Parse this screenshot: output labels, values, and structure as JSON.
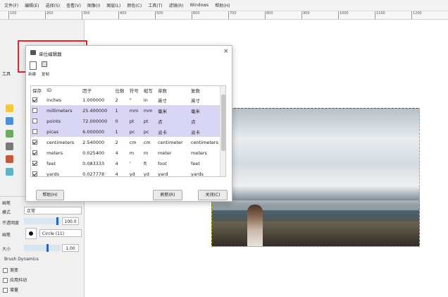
{
  "menu": [
    "文件(F)",
    "编辑(E)",
    "选择(S)",
    "查看(V)",
    "图像(I)",
    "图层(L)",
    "颜色(C)",
    "工具(T)",
    "滤镜(R)",
    "Windows",
    "帮助(H)"
  ],
  "ruler": [
    "100",
    "200",
    "300",
    "400",
    "500",
    "600",
    "700",
    "800",
    "900",
    "1000",
    "1100",
    "1200"
  ],
  "dialog": {
    "title": "单位编辑器",
    "toolbar_labels": [
      "新建",
      "复制"
    ],
    "columns": [
      "保存",
      "ID",
      "因子",
      "位数",
      "符号",
      "缩写",
      "单数",
      "复数"
    ],
    "rows": [
      {
        "saved": true,
        "id": "inches",
        "factor": "1.000000",
        "digits": "2",
        "symbol": "\"",
        "abbr": "in",
        "singular": "英寸",
        "plural": "英寸",
        "selected": false
      },
      {
        "saved": false,
        "id": "millimeters",
        "factor": "25.400000",
        "digits": "1",
        "symbol": "mm",
        "abbr": "mm",
        "singular": "毫米",
        "plural": "毫米",
        "selected": true
      },
      {
        "saved": false,
        "id": "points",
        "factor": "72.000000",
        "digits": "0",
        "symbol": "pt",
        "abbr": "pt",
        "singular": "点",
        "plural": "点",
        "selected": true
      },
      {
        "saved": false,
        "id": "picas",
        "factor": "6.000000",
        "digits": "1",
        "symbol": "pc",
        "abbr": "pc",
        "singular": "派卡",
        "plural": "派卡",
        "selected": true
      },
      {
        "saved": true,
        "id": "centimeters",
        "factor": "2.540000",
        "digits": "2",
        "symbol": "cm",
        "abbr": "cm",
        "singular": "centimeter",
        "plural": "centimeters",
        "selected": false
      },
      {
        "saved": true,
        "id": "meters",
        "factor": "0.025400",
        "digits": "4",
        "symbol": "m",
        "abbr": "m",
        "singular": "meter",
        "plural": "meters",
        "selected": false
      },
      {
        "saved": true,
        "id": "feet",
        "factor": "0.083333",
        "digits": "4",
        "symbol": "'",
        "abbr": "ft",
        "singular": "foot",
        "plural": "feet",
        "selected": false
      },
      {
        "saved": true,
        "id": "yards",
        "factor": "0.027778",
        "digits": "4",
        "symbol": "yd",
        "abbr": "yd",
        "singular": "yard",
        "plural": "yards",
        "selected": false
      }
    ],
    "help_button": "帮助(H)",
    "refresh_button": "刷新(R)",
    "close_button": "关闭(C)"
  },
  "left_panel": {
    "tools_label": "工具",
    "mode_label": "模式",
    "mode_value": "正常",
    "opacity_label": "不透明度",
    "opacity_value": "100.0",
    "brush_label": "画笔",
    "brush_value": "Circle (11)",
    "size_label": "大小",
    "size_value": "1.00",
    "dynamics_label": "Brush Dynamics",
    "options": [
      "渐变",
      "应用抖动",
      "增量"
    ]
  }
}
